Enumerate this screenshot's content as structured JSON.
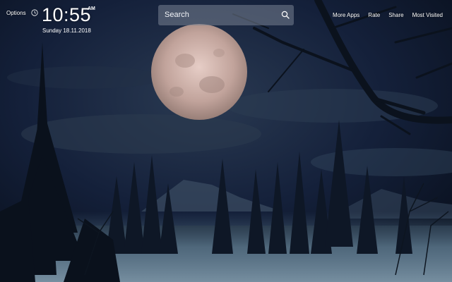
{
  "options_label": "Options",
  "clock": {
    "time": "10:55",
    "ampm": "AM",
    "date": "Sunday  18.11.2018"
  },
  "search": {
    "placeholder": "Search",
    "icon": "search-icon"
  },
  "nav": {
    "more_apps": "More Apps",
    "rate": "Rate",
    "share": "Share",
    "most_visited": "Most Visited"
  },
  "icons": {
    "clock": "clock-icon",
    "search": "search-icon"
  },
  "colors": {
    "sky": "#0b1220",
    "moon": "#c9b0a8",
    "mist": "#6f8fa6",
    "search_bg": "#7a8291"
  }
}
